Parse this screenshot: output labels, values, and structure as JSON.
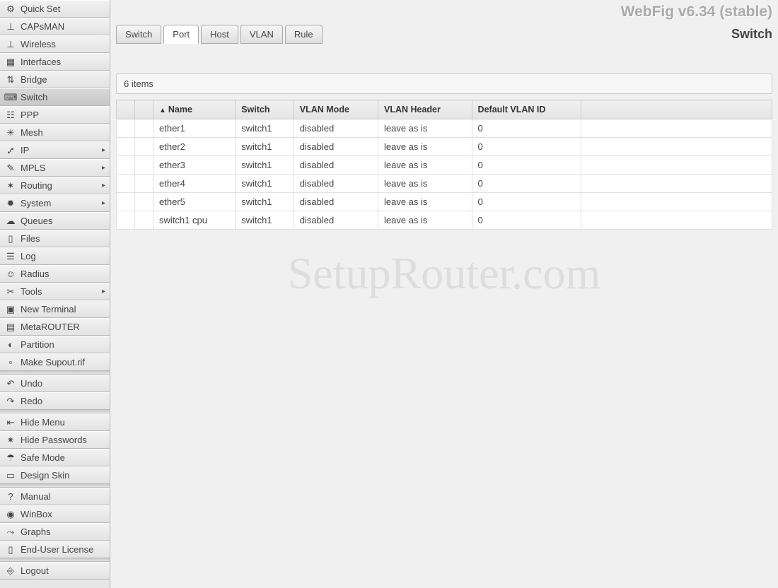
{
  "app": {
    "title": "WebFig v6.34 (stable)",
    "page_title": "Switch"
  },
  "sidebar": {
    "groups": [
      {
        "items": [
          {
            "id": "quick-set",
            "label": "Quick Set",
            "icon": "⚙",
            "expandable": false
          },
          {
            "id": "capsman",
            "label": "CAPsMAN",
            "icon": "⊥",
            "expandable": false
          },
          {
            "id": "wireless",
            "label": "Wireless",
            "icon": "⊥",
            "expandable": false
          },
          {
            "id": "interfaces",
            "label": "Interfaces",
            "icon": "▦",
            "expandable": false
          },
          {
            "id": "bridge",
            "label": "Bridge",
            "icon": "⇅",
            "expandable": false
          },
          {
            "id": "switch",
            "label": "Switch",
            "icon": "⌨",
            "expandable": false,
            "selected": true
          },
          {
            "id": "ppp",
            "label": "PPP",
            "icon": "☷",
            "expandable": false
          },
          {
            "id": "mesh",
            "label": "Mesh",
            "icon": "✳",
            "expandable": false
          },
          {
            "id": "ip",
            "label": "IP",
            "icon": "⑇",
            "expandable": true
          },
          {
            "id": "mpls",
            "label": "MPLS",
            "icon": "✎",
            "expandable": true
          },
          {
            "id": "routing",
            "label": "Routing",
            "icon": "✶",
            "expandable": true
          },
          {
            "id": "system",
            "label": "System",
            "icon": "✹",
            "expandable": true
          },
          {
            "id": "queues",
            "label": "Queues",
            "icon": "☁",
            "expandable": false
          },
          {
            "id": "files",
            "label": "Files",
            "icon": "▯",
            "expandable": false
          },
          {
            "id": "log",
            "label": "Log",
            "icon": "☰",
            "expandable": false
          },
          {
            "id": "radius",
            "label": "Radius",
            "icon": "☺",
            "expandable": false
          },
          {
            "id": "tools",
            "label": "Tools",
            "icon": "✂",
            "expandable": true
          },
          {
            "id": "new-terminal",
            "label": "New Terminal",
            "icon": "▣",
            "expandable": false
          },
          {
            "id": "metarouter",
            "label": "MetaROUTER",
            "icon": "▤",
            "expandable": false
          },
          {
            "id": "partition",
            "label": "Partition",
            "icon": "◐",
            "expandable": false
          },
          {
            "id": "make-supout",
            "label": "Make Supout.rif",
            "icon": "▫",
            "expandable": false
          }
        ]
      },
      {
        "items": [
          {
            "id": "undo",
            "label": "Undo",
            "icon": "↶",
            "expandable": false
          },
          {
            "id": "redo",
            "label": "Redo",
            "icon": "↷",
            "expandable": false
          }
        ]
      },
      {
        "items": [
          {
            "id": "hide-menu",
            "label": "Hide Menu",
            "icon": "⇤",
            "expandable": false
          },
          {
            "id": "hide-passwords",
            "label": "Hide Passwords",
            "icon": "⁕",
            "expandable": false
          },
          {
            "id": "safe-mode",
            "label": "Safe Mode",
            "icon": "☂",
            "expandable": false
          },
          {
            "id": "design-skin",
            "label": "Design Skin",
            "icon": "▭",
            "expandable": false
          }
        ]
      },
      {
        "items": [
          {
            "id": "manual",
            "label": "Manual",
            "icon": "?",
            "expandable": false
          },
          {
            "id": "winbox",
            "label": "WinBox",
            "icon": "◉",
            "expandable": false
          },
          {
            "id": "graphs",
            "label": "Graphs",
            "icon": "⤳",
            "expandable": false
          },
          {
            "id": "end-user-license",
            "label": "End-User License",
            "icon": "▯",
            "expandable": false
          }
        ]
      },
      {
        "items": [
          {
            "id": "logout",
            "label": "Logout",
            "icon": "⎆",
            "expandable": false
          }
        ]
      }
    ]
  },
  "tabs": [
    {
      "id": "switch",
      "label": "Switch",
      "active": false
    },
    {
      "id": "port",
      "label": "Port",
      "active": true
    },
    {
      "id": "host",
      "label": "Host",
      "active": false
    },
    {
      "id": "vlan",
      "label": "VLAN",
      "active": false
    },
    {
      "id": "rule",
      "label": "Rule",
      "active": false
    }
  ],
  "table": {
    "count_text": "6 items",
    "sort_indicator": "▲",
    "columns": [
      "",
      "",
      "Name",
      "Switch",
      "VLAN Mode",
      "VLAN Header",
      "Default VLAN ID",
      ""
    ],
    "rows": [
      {
        "name": "ether1",
        "switch": "switch1",
        "vlan_mode": "disabled",
        "vlan_header": "leave as is",
        "default_vlan_id": "0"
      },
      {
        "name": "ether2",
        "switch": "switch1",
        "vlan_mode": "disabled",
        "vlan_header": "leave as is",
        "default_vlan_id": "0"
      },
      {
        "name": "ether3",
        "switch": "switch1",
        "vlan_mode": "disabled",
        "vlan_header": "leave as is",
        "default_vlan_id": "0"
      },
      {
        "name": "ether4",
        "switch": "switch1",
        "vlan_mode": "disabled",
        "vlan_header": "leave as is",
        "default_vlan_id": "0"
      },
      {
        "name": "ether5",
        "switch": "switch1",
        "vlan_mode": "disabled",
        "vlan_header": "leave as is",
        "default_vlan_id": "0"
      },
      {
        "name": "switch1 cpu",
        "switch": "switch1",
        "vlan_mode": "disabled",
        "vlan_header": "leave as is",
        "default_vlan_id": "0"
      }
    ]
  },
  "watermark": "SetupRouter.com"
}
